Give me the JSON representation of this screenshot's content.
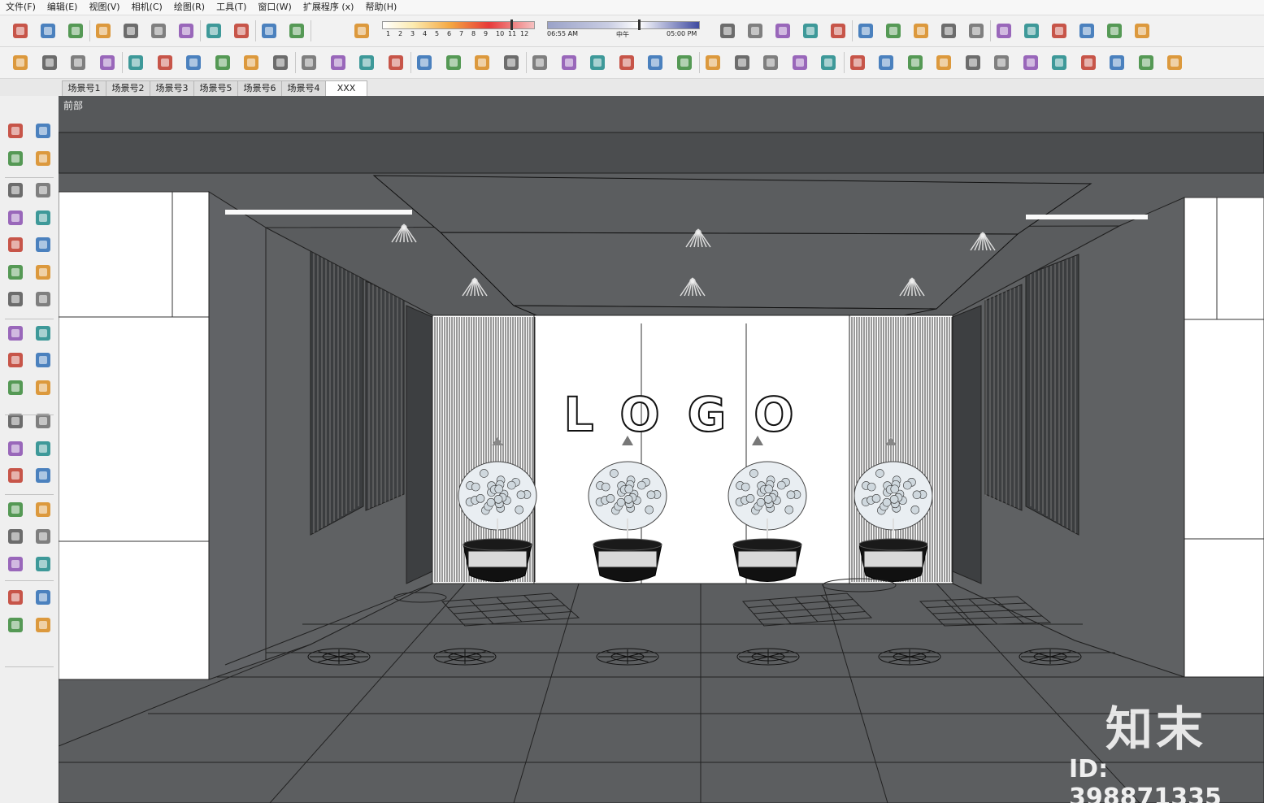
{
  "menu": [
    "文件(F)",
    "编辑(E)",
    "视图(V)",
    "相机(C)",
    "绘图(R)",
    "工具(T)",
    "窗口(W)",
    "扩展程序 (x)",
    "帮助(H)"
  ],
  "shadow": {
    "month_labels": [
      "1",
      "2",
      "3",
      "4",
      "5",
      "6",
      "7",
      "8",
      "9",
      "10",
      "11",
      "12"
    ],
    "time_start": "06:55 AM",
    "time_mid": "中午",
    "time_end": "05:00 PM"
  },
  "scenes": [
    {
      "label": "场景号1",
      "active": false
    },
    {
      "label": "场景号2",
      "active": false
    },
    {
      "label": "场景号3",
      "active": false
    },
    {
      "label": "场景号5",
      "active": false
    },
    {
      "label": "场景号6",
      "active": false
    },
    {
      "label": "场景号4",
      "active": false
    },
    {
      "label": "XXX",
      "active": true
    }
  ],
  "viewport": {
    "view_label": "前部",
    "logo_text": "LOGO"
  },
  "watermark": {
    "brand": "知末",
    "id_text": "ID: 398871335"
  },
  "icons_top": [
    "new-model-icon",
    "open-icon",
    "save-icon",
    "cut-icon",
    "copy-icon",
    "paste-icon",
    "erase-icon",
    "undo-icon",
    "redo-icon",
    "print-icon",
    "model-info-icon",
    "shadow-toggle-icon",
    "orbit-icon",
    "xray-icon",
    "shaded-icon",
    "texture-icon",
    "iso-view-icon",
    "top-view-icon",
    "front-view-icon",
    "right-view-icon",
    "back-view-icon",
    "left-view-icon",
    "wireframe-icon",
    "hidden-line-icon",
    "shaded-style-icon",
    "textured-style-icon",
    "monochrome-icon",
    "section-icon"
  ],
  "icons_second": [
    "component-icon",
    "refresh-icon",
    "camera-icon",
    "tag-icon",
    "photo-icon",
    "vr-icon",
    "plugin-icon",
    "tree-icon",
    "settings-icon",
    "sound-icon",
    "sliders-icon",
    "eye-sliders-icon",
    "chat-icon",
    "info-icon",
    "image-export-icon",
    "image-import-icon",
    "exe-icon",
    "web-icon",
    "layout1-icon",
    "layout2-icon",
    "layout3-icon",
    "layout4-icon",
    "layout5-icon",
    "layout6-icon",
    "globe-icon",
    "v-ray-icon",
    "teapot-icon",
    "hand-teapot-icon",
    "light-icon",
    "plane-icon",
    "box-icon",
    "cube-frame-icon",
    "cloud-icon",
    "lock-icon",
    "lamp-icon",
    "sphere-light-icon",
    "cone-light-icon",
    "spot-icon",
    "sun-icon",
    "dome-icon",
    "mesh-icon"
  ],
  "icons_left": [
    "select-icon",
    "component-make-icon",
    "paint-bucket-icon",
    "eraser-icon",
    "pencil-icon",
    "freehand-icon",
    "rectangle-icon",
    "rotated-rect-icon",
    "circle-icon",
    "polygon-icon",
    "arc-icon",
    "pie-icon",
    "arc2-icon",
    "arc3-icon",
    "move-icon",
    "push-pull-icon",
    "rotate-icon",
    "follow-me-icon",
    "scale-icon",
    "offset-icon",
    "tape-measure-icon",
    "dimension-icon",
    "protractor-icon",
    "text-icon",
    "axes-icon",
    "3d-text-icon",
    "orbit-tool-icon",
    "pan-icon",
    "zoom-icon",
    "zoom-window-icon",
    "zoom-extents-icon",
    "previous-view-icon",
    "walk-icon",
    "look-around-icon",
    "footprint-icon",
    "position-camera-icon"
  ]
}
